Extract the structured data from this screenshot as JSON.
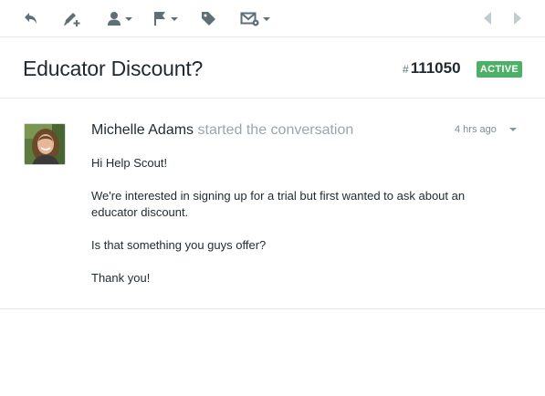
{
  "toolbar": {
    "buttons": [
      {
        "name": "reply-button",
        "icon": "reply-icon"
      },
      {
        "name": "note-button",
        "icon": "pen-plus-icon"
      },
      {
        "name": "assign-button",
        "icon": "user-icon"
      },
      {
        "name": "flag-button",
        "icon": "flag-icon"
      },
      {
        "name": "tag-button",
        "icon": "tag-icon"
      },
      {
        "name": "email-button",
        "icon": "envelope-gear-icon"
      }
    ],
    "nav": [
      {
        "name": "previous-button",
        "icon": "arrow-left-icon"
      },
      {
        "name": "next-button",
        "icon": "arrow-right-icon"
      }
    ]
  },
  "conversation": {
    "subject": "Educator Discount?",
    "hash": "#",
    "id": "111050",
    "status": "ACTIVE",
    "status_color": "#4cb167"
  },
  "thread": {
    "author": "Michelle Adams",
    "action": "started the conversation",
    "time": "4 hrs ago",
    "paragraphs": [
      "Hi Help Scout!",
      "We're interested in signing up for a trial but first wanted to ask about an educator discount.",
      "Is that something you guys offer?",
      "Thank you!"
    ]
  }
}
